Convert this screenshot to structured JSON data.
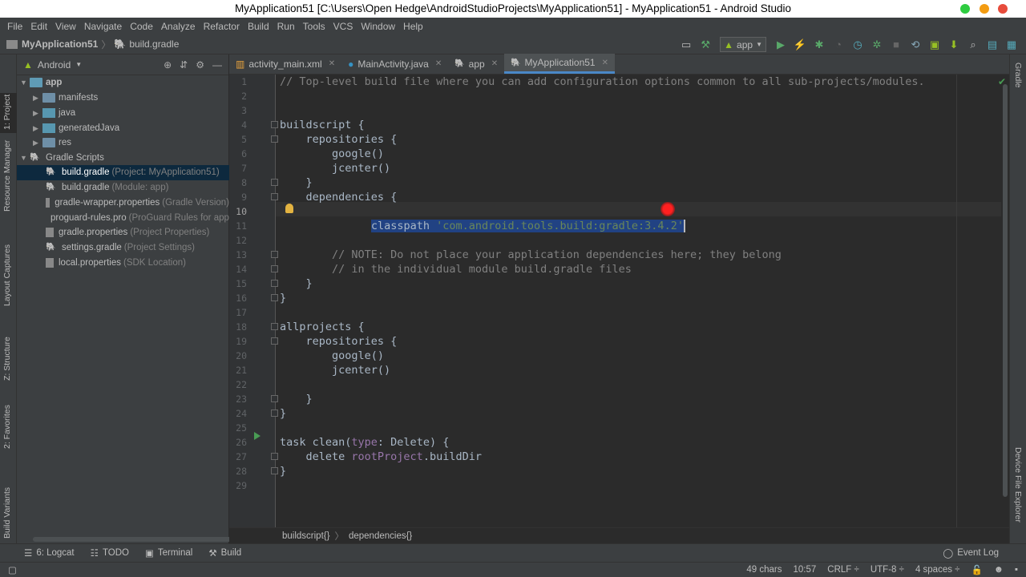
{
  "window": {
    "title": "MyApplication51 [C:\\Users\\Open Hedge\\AndroidStudioProjects\\MyApplication51] - MyApplication51 - Android Studio"
  },
  "menu": [
    "File",
    "Edit",
    "View",
    "Navigate",
    "Code",
    "Analyze",
    "Refactor",
    "Build",
    "Run",
    "Tools",
    "VCS",
    "Window",
    "Help"
  ],
  "breadcrumb": {
    "project": "MyApplication51",
    "file": "build.gradle"
  },
  "toolbar": {
    "run_config": "app"
  },
  "left_tabs": [
    "1: Project",
    "Resource Manager",
    "Layout Captures",
    "Z: Structure",
    "2: Favorites",
    "Build Variants"
  ],
  "right_tabs": [
    "Gradle",
    "Device File Explorer"
  ],
  "project_panel": {
    "view": "Android",
    "tree": [
      {
        "label": "app",
        "hint": ""
      },
      {
        "label": "manifests",
        "hint": ""
      },
      {
        "label": "java",
        "hint": ""
      },
      {
        "label": "generatedJava",
        "hint": ""
      },
      {
        "label": "res",
        "hint": ""
      },
      {
        "label": "Gradle Scripts",
        "hint": ""
      },
      {
        "label": "build.gradle",
        "hint": "(Project: MyApplication51)"
      },
      {
        "label": "build.gradle",
        "hint": "(Module: app)"
      },
      {
        "label": "gradle-wrapper.properties",
        "hint": "(Gradle Version)"
      },
      {
        "label": "proguard-rules.pro",
        "hint": "(ProGuard Rules for app)"
      },
      {
        "label": "gradle.properties",
        "hint": "(Project Properties)"
      },
      {
        "label": "settings.gradle",
        "hint": "(Project Settings)"
      },
      {
        "label": "local.properties",
        "hint": "(SDK Location)"
      }
    ]
  },
  "editor_tabs": [
    "activity_main.xml",
    "MainActivity.java",
    "app",
    "MyApplication51"
  ],
  "code": {
    "line_numbers": [
      "1",
      "2",
      "3",
      "4",
      "5",
      "6",
      "7",
      "8",
      "9",
      "10",
      "11",
      "12",
      "13",
      "14",
      "15",
      "16",
      "17",
      "18",
      "19",
      "20",
      "21",
      "22",
      "23",
      "24",
      "25",
      "26",
      "27",
      "28",
      "29"
    ],
    "l1": "// Top-level build file where you can add configuration options common to all sub-projects/modules.",
    "l4": "buildscript {",
    "l5": "    repositories {",
    "l6": "        google()",
    "l7": "        jcenter()",
    "l8": "    }",
    "l9": "    dependencies {",
    "l10_indent": "        ",
    "l10_kw": "classpath ",
    "l10_str": "'com.android.tools.build:gradle:3.4.2'",
    "l13": "        // NOTE: Do not place your application dependencies here; they belong",
    "l14": "        // in the individual module build.gradle files",
    "l15": "    }",
    "l16": "}",
    "l18": "allprojects {",
    "l19": "    repositories {",
    "l20": "        google()",
    "l21": "        jcenter()",
    "l23": "    }",
    "l24": "}",
    "l26_a": "task clean(",
    "l26_prm": "type",
    "l26_b": ": Delete) {",
    "l27_a": "    delete ",
    "l27_prm": "rootProject",
    "l27_b": ".buildDir",
    "l28": "}"
  },
  "editor_breadcrumb": [
    "buildscript{}",
    "dependencies{}"
  ],
  "tool_windows": [
    "6: Logcat",
    "TODO",
    "Terminal",
    "Build"
  ],
  "event_log": "Event Log",
  "status": {
    "chars": "49 chars",
    "position": "10:57",
    "line_sep": "CRLF ÷",
    "encoding": "UTF-8 ÷",
    "indent": "4 spaces ÷"
  }
}
